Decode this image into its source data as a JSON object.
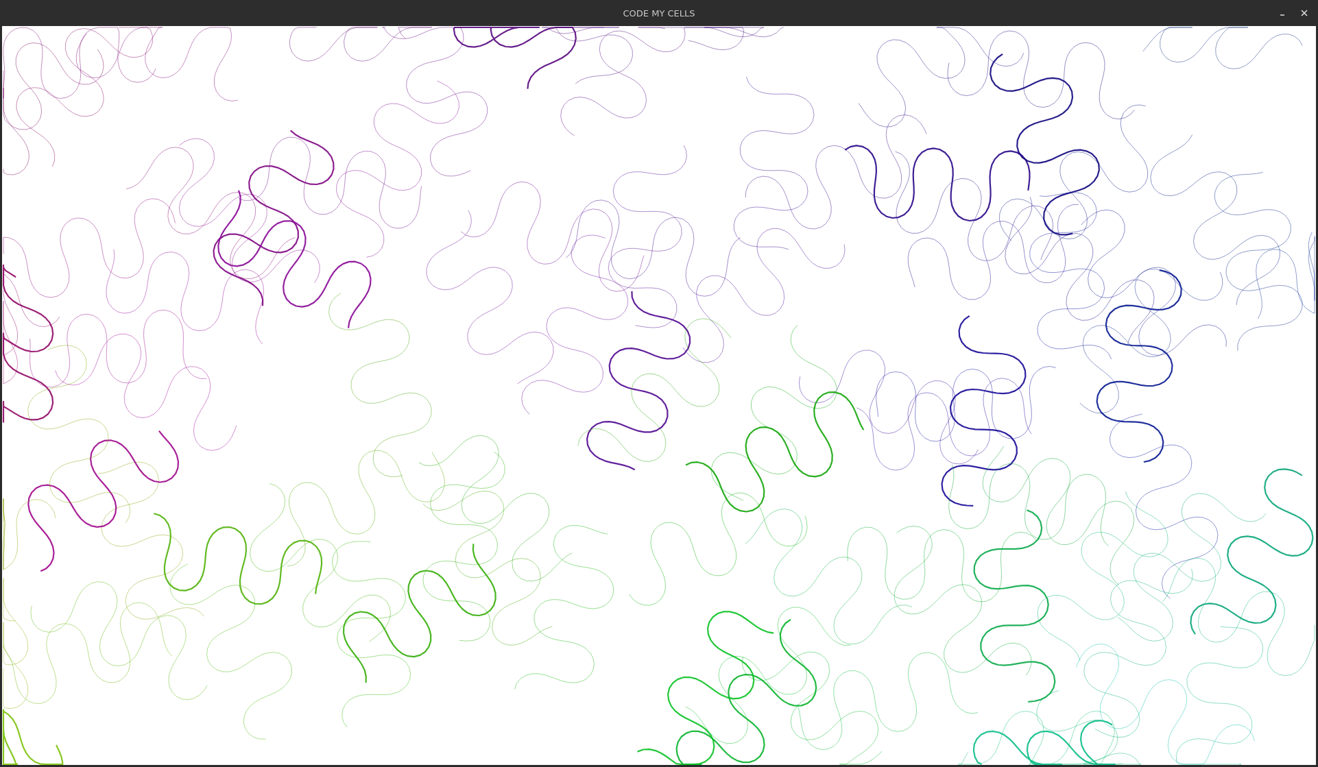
{
  "window": {
    "title": "CODE MY CELLS"
  }
}
